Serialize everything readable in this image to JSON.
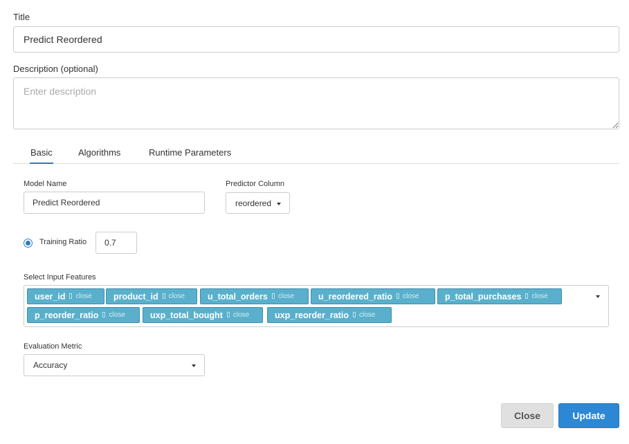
{
  "title_section": {
    "label": "Title",
    "value": "Predict Reordered"
  },
  "description_section": {
    "label": "Description (optional)",
    "value": "",
    "placeholder": "Enter description"
  },
  "tabs": [
    {
      "label": "Basic",
      "active": true
    },
    {
      "label": "Algorithms",
      "active": false
    },
    {
      "label": "Runtime Parameters",
      "active": false
    }
  ],
  "basic": {
    "model_name": {
      "label": "Model Name",
      "value": "Predict Reordered"
    },
    "predictor_column": {
      "label": "Predictor Column",
      "value": "reordered"
    },
    "training_ratio": {
      "label": "Training Ratio",
      "value": "0.7",
      "selected": true
    },
    "input_features": {
      "label": "Select Input Features",
      "chips": [
        {
          "label": "user_id",
          "close": "close"
        },
        {
          "label": "product_id",
          "close": "close"
        },
        {
          "label": "u_total_orders",
          "close": "close"
        },
        {
          "label": "u_reordered_ratio",
          "close": "close"
        },
        {
          "label": "p_total_purchases",
          "close": "close"
        },
        {
          "label": "p_reorder_ratio",
          "close": "close"
        },
        {
          "label": "uxp_total_bought",
          "close": "close"
        },
        {
          "label": "uxp_reorder_ratio",
          "close": "close"
        }
      ]
    },
    "evaluation_metric": {
      "label": "Evaluation Metric",
      "value": "Accuracy"
    }
  },
  "footer": {
    "close_label": "Close",
    "update_label": "Update"
  },
  "colors": {
    "accent": "#2c87d4",
    "chip": "#5ab0cc",
    "close_button": "#e0e0e0"
  }
}
